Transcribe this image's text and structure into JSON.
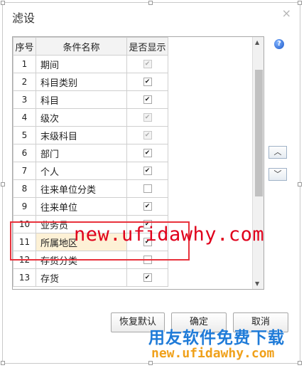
{
  "dialog": {
    "title": "滤设",
    "close_glyph": "×",
    "help_glyph": "?"
  },
  "table": {
    "headers": [
      "序号",
      "条件名称",
      "是否显示"
    ],
    "rows": [
      {
        "seq": "1",
        "name": "期间",
        "checked": true,
        "disabled": true
      },
      {
        "seq": "2",
        "name": "科目类别",
        "checked": true,
        "disabled": false
      },
      {
        "seq": "3",
        "name": "科目",
        "checked": true,
        "disabled": false
      },
      {
        "seq": "4",
        "name": "级次",
        "checked": true,
        "disabled": true
      },
      {
        "seq": "5",
        "name": "末级科目",
        "checked": true,
        "disabled": true
      },
      {
        "seq": "6",
        "name": "部门",
        "checked": true,
        "disabled": false
      },
      {
        "seq": "7",
        "name": "个人",
        "checked": true,
        "disabled": false
      },
      {
        "seq": "8",
        "name": "往来单位分类",
        "checked": false,
        "disabled": false
      },
      {
        "seq": "9",
        "name": "往来单位",
        "checked": true,
        "disabled": false
      },
      {
        "seq": "10",
        "name": "业务员",
        "checked": true,
        "disabled": false
      },
      {
        "seq": "11",
        "name": "所属地区",
        "checked": true,
        "disabled": false,
        "selected": true
      },
      {
        "seq": "12",
        "name": "存货分类",
        "checked": false,
        "disabled": false
      },
      {
        "seq": "13",
        "name": "存货",
        "checked": true,
        "disabled": false
      }
    ]
  },
  "side_buttons": {
    "up": "︿",
    "down": "﹀"
  },
  "buttons": {
    "restore_default": "恢复默认",
    "ok": "确定",
    "cancel": "取消"
  },
  "watermark": {
    "main": "new.ufidawhy.com",
    "title": "用友软件免费下载",
    "url": "new.ufidawhy.com"
  },
  "colors": {
    "highlight_box": "#e8323c",
    "watermark_red": "#e0001b",
    "watermark_blue": "#1f7bd8",
    "watermark_orange": "#f0a11b"
  }
}
